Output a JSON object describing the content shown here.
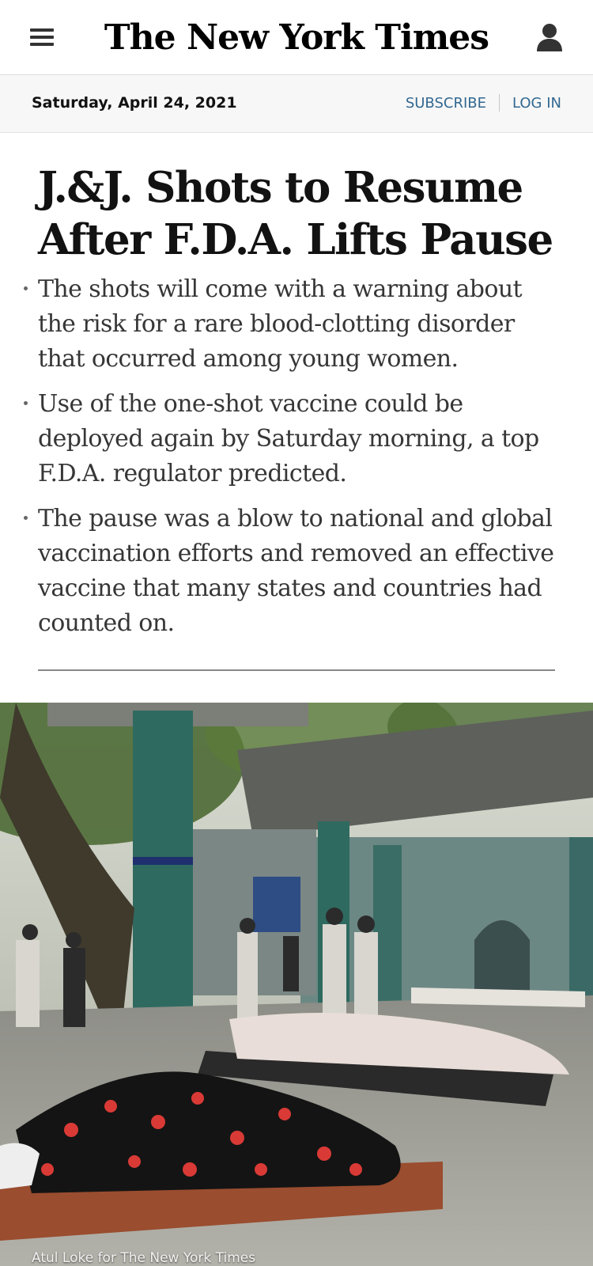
{
  "header": {
    "masthead": "The New York Times",
    "menu_icon": "hamburger-menu-icon",
    "account_icon": "account-icon"
  },
  "subbar": {
    "date": "Saturday, April 24, 2021",
    "subscribe_label": "SUBSCRIBE",
    "login_label": "LOG IN"
  },
  "article": {
    "headline": "J.&J. Shots to Resume After F.D.A. Lifts Pause",
    "summary": [
      "The shots will come with a warning about the risk for a rare blood-clotting disorder that occurred among young women.",
      "Use of the one-shot vaccine could be deployed again by Saturday morning, a top F.D.A. regulator predicted.",
      "The pause was a blow to national and global vaccination efforts and removed an effective vaccine that many states and countries had counted on."
    ]
  },
  "photo": {
    "credit": "Atul Loke for The New York Times"
  },
  "colors": {
    "link": "#326891",
    "text": "#121212",
    "summary_text": "#363636"
  }
}
